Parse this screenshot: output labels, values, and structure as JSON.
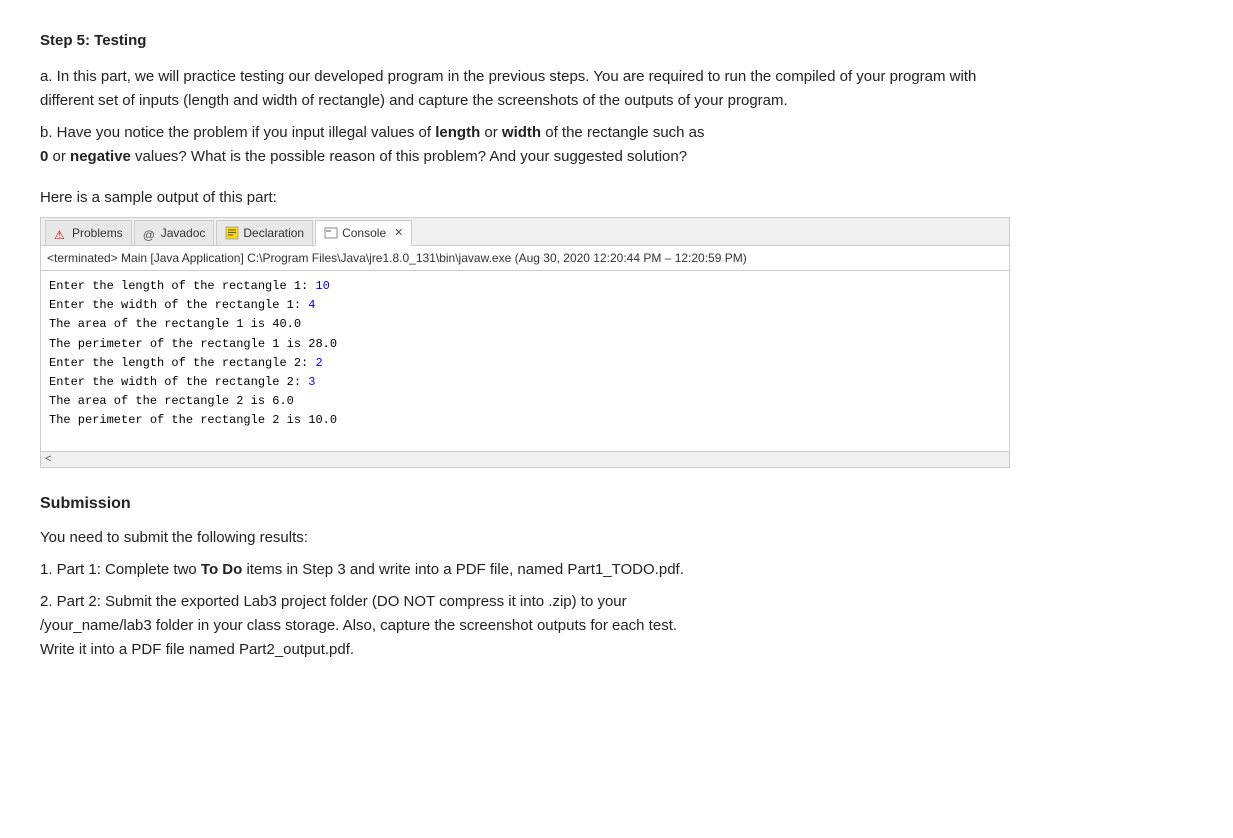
{
  "step": {
    "title": "Step 5: Testing",
    "paragraphs": {
      "a": "a. In this part, we will practice testing our developed program in the previous steps. You are required to run the compiled of your program with different set of inputs (length and width of rectangle) and capture the screenshots of the outputs of your program.",
      "b_pre1": "b. Have you notice the problem if you input illegal values of ",
      "b_bold1": "length",
      "b_mid1": " or ",
      "b_bold2": "width",
      "b_post1": " of the rectangle such as",
      "b_pre2": "",
      "b_bold3": "0",
      "b_mid2": " or ",
      "b_bold4": "negative",
      "b_post2": " values? What is the possible reason of this problem? And your suggested solution?"
    },
    "sample_label": "Here is a sample output of this part:"
  },
  "eclipse": {
    "tabs": [
      {
        "label": "Problems",
        "icon": "⚠",
        "active": false
      },
      {
        "label": "Javadoc",
        "icon": "@",
        "active": false
      },
      {
        "label": "Declaration",
        "icon": "📄",
        "active": false
      },
      {
        "label": "Console",
        "icon": "🖥",
        "active": true,
        "close": true
      }
    ],
    "header": "<terminated> Main [Java Application] C:\\Program Files\\Java\\jre1.8.0_131\\bin\\javaw.exe  (Aug 30, 2020 12:20:44 PM – 12:20:59 PM)",
    "console_lines": [
      {
        "text": "Enter the length of the rectangle 1: ",
        "value": "10"
      },
      {
        "text": "Enter the width of the rectangle 1: ",
        "value": "4"
      },
      {
        "text": "The area of the rectangle 1 is 40.0",
        "value": null
      },
      {
        "text": "The perimeter of the rectangle 1 is 28.0",
        "value": null
      },
      {
        "text": "Enter the length of the rectangle 2: ",
        "value": "2"
      },
      {
        "text": "Enter the width of the rectangle 2: ",
        "value": "3"
      },
      {
        "text": "The area of the rectangle 2 is 6.0",
        "value": null
      },
      {
        "text": "The perimeter of the rectangle 2 is 10.0",
        "value": null
      }
    ]
  },
  "submission": {
    "title": "Submission",
    "intro": "You need to submit the following results:",
    "items": [
      {
        "prefix": "1. Part 1: Complete two ",
        "bold": "To Do",
        "suffix": " items in Step 3 and write into a PDF file, named Part1_TODO.pdf."
      },
      {
        "prefix": "2. Part 2: Submit the exported Lab3 project folder (DO NOT compress it into .zip) to your /your_name/lab3 folder in your class storage. Also, capture the screenshot outputs for each test. Write it into a PDF file named Part2_output.pdf.",
        "bold": null,
        "suffix": null
      }
    ]
  }
}
